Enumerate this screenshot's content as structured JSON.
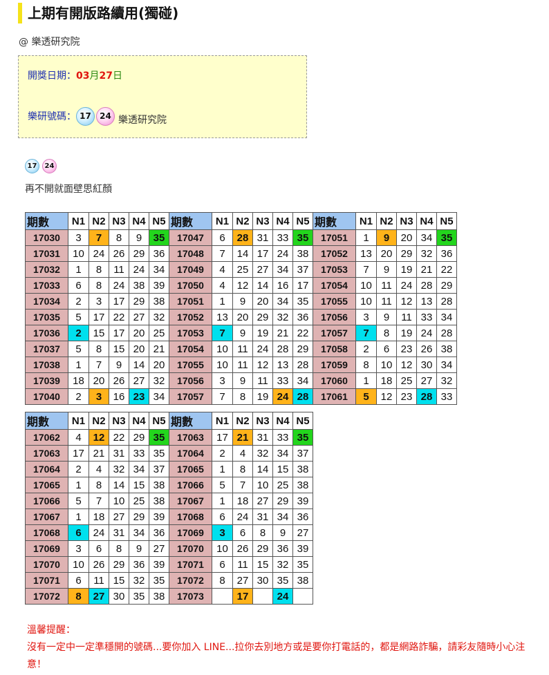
{
  "title": "上期有開版路續用(獨碰)",
  "author": "@ 樂透研究院",
  "info": {
    "date_label": "開獎日期：",
    "month": "03",
    "month_unit": "月",
    "day": "27",
    "day_unit": "日",
    "number_label": "樂研號碼：",
    "balls": [
      "17",
      "24"
    ],
    "site": "樂透研究院"
  },
  "picks": [
    "17",
    "24"
  ],
  "remark": "再不開就面壁思紅顏",
  "headers": [
    "期數",
    "N1",
    "N2",
    "N3",
    "N4",
    "N5"
  ],
  "blocks": [
    [
      {
        "period": "17030",
        "nums": [
          "3",
          "7",
          "8",
          "9",
          "35"
        ],
        "hl": [
          "",
          "o",
          "",
          "",
          "g"
        ]
      },
      {
        "period": "17031",
        "nums": [
          "10",
          "24",
          "26",
          "29",
          "36"
        ],
        "hl": [
          "",
          "",
          "",
          "",
          ""
        ]
      },
      {
        "period": "17032",
        "nums": [
          "1",
          "8",
          "11",
          "24",
          "34"
        ],
        "hl": [
          "",
          "",
          "",
          "",
          ""
        ]
      },
      {
        "period": "17033",
        "nums": [
          "6",
          "8",
          "24",
          "38",
          "39"
        ],
        "hl": [
          "",
          "",
          "",
          "",
          ""
        ]
      },
      {
        "period": "17034",
        "nums": [
          "2",
          "3",
          "17",
          "29",
          "38"
        ],
        "hl": [
          "",
          "",
          "",
          "",
          ""
        ]
      },
      {
        "period": "17035",
        "nums": [
          "5",
          "17",
          "22",
          "27",
          "32"
        ],
        "hl": [
          "",
          "",
          "",
          "",
          ""
        ]
      },
      {
        "period": "17036",
        "nums": [
          "2",
          "15",
          "17",
          "20",
          "25"
        ],
        "hl": [
          "c",
          "",
          "",
          "",
          ""
        ]
      },
      {
        "period": "17037",
        "nums": [
          "5",
          "8",
          "15",
          "20",
          "21"
        ],
        "hl": [
          "",
          "",
          "",
          "",
          ""
        ]
      },
      {
        "period": "17038",
        "nums": [
          "1",
          "7",
          "9",
          "14",
          "20"
        ],
        "hl": [
          "",
          "",
          "",
          "",
          ""
        ]
      },
      {
        "period": "17039",
        "nums": [
          "18",
          "20",
          "26",
          "27",
          "32"
        ],
        "hl": [
          "",
          "",
          "",
          "",
          ""
        ]
      },
      {
        "period": "17040",
        "nums": [
          "2",
          "3",
          "16",
          "23",
          "34"
        ],
        "hl": [
          "",
          "o",
          "",
          "c",
          ""
        ]
      }
    ],
    [
      {
        "period": "17047",
        "nums": [
          "6",
          "28",
          "31",
          "33",
          "35"
        ],
        "hl": [
          "",
          "o",
          "",
          "",
          "g"
        ]
      },
      {
        "period": "17048",
        "nums": [
          "7",
          "14",
          "17",
          "24",
          "38"
        ],
        "hl": [
          "",
          "",
          "",
          "",
          ""
        ]
      },
      {
        "period": "17049",
        "nums": [
          "4",
          "25",
          "27",
          "34",
          "37"
        ],
        "hl": [
          "",
          "",
          "",
          "",
          ""
        ]
      },
      {
        "period": "17050",
        "nums": [
          "4",
          "12",
          "14",
          "16",
          "17"
        ],
        "hl": [
          "",
          "",
          "",
          "",
          ""
        ]
      },
      {
        "period": "17051",
        "nums": [
          "1",
          "9",
          "20",
          "34",
          "35"
        ],
        "hl": [
          "",
          "",
          "",
          "",
          ""
        ]
      },
      {
        "period": "17052",
        "nums": [
          "13",
          "20",
          "29",
          "32",
          "36"
        ],
        "hl": [
          "",
          "",
          "",
          "",
          ""
        ]
      },
      {
        "period": "17053",
        "nums": [
          "7",
          "9",
          "19",
          "21",
          "22"
        ],
        "hl": [
          "c",
          "",
          "",
          "",
          ""
        ]
      },
      {
        "period": "17054",
        "nums": [
          "10",
          "11",
          "24",
          "28",
          "29"
        ],
        "hl": [
          "",
          "",
          "",
          "",
          ""
        ]
      },
      {
        "period": "17055",
        "nums": [
          "10",
          "11",
          "12",
          "13",
          "28"
        ],
        "hl": [
          "",
          "",
          "",
          "",
          ""
        ]
      },
      {
        "period": "17056",
        "nums": [
          "3",
          "9",
          "11",
          "33",
          "34"
        ],
        "hl": [
          "",
          "",
          "",
          "",
          ""
        ]
      },
      {
        "period": "17057",
        "nums": [
          "7",
          "8",
          "19",
          "24",
          "28"
        ],
        "hl": [
          "",
          "",
          "",
          "o",
          "c"
        ]
      }
    ],
    [
      {
        "period": "17051",
        "nums": [
          "1",
          "9",
          "20",
          "34",
          "35"
        ],
        "hl": [
          "",
          "o",
          "",
          "",
          "g"
        ]
      },
      {
        "period": "17052",
        "nums": [
          "13",
          "20",
          "29",
          "32",
          "36"
        ],
        "hl": [
          "",
          "",
          "",
          "",
          ""
        ]
      },
      {
        "period": "17053",
        "nums": [
          "7",
          "9",
          "19",
          "21",
          "22"
        ],
        "hl": [
          "",
          "",
          "",
          "",
          ""
        ]
      },
      {
        "period": "17054",
        "nums": [
          "10",
          "11",
          "24",
          "28",
          "29"
        ],
        "hl": [
          "",
          "",
          "",
          "",
          ""
        ]
      },
      {
        "period": "17055",
        "nums": [
          "10",
          "11",
          "12",
          "13",
          "28"
        ],
        "hl": [
          "",
          "",
          "",
          "",
          ""
        ]
      },
      {
        "period": "17056",
        "nums": [
          "3",
          "9",
          "11",
          "33",
          "34"
        ],
        "hl": [
          "",
          "",
          "",
          "",
          ""
        ]
      },
      {
        "period": "17057",
        "nums": [
          "7",
          "8",
          "19",
          "24",
          "28"
        ],
        "hl": [
          "c",
          "",
          "",
          "",
          ""
        ]
      },
      {
        "period": "17058",
        "nums": [
          "2",
          "6",
          "23",
          "26",
          "38"
        ],
        "hl": [
          "",
          "",
          "",
          "",
          ""
        ]
      },
      {
        "period": "17059",
        "nums": [
          "8",
          "10",
          "12",
          "30",
          "34"
        ],
        "hl": [
          "",
          "",
          "",
          "",
          ""
        ]
      },
      {
        "period": "17060",
        "nums": [
          "1",
          "18",
          "25",
          "27",
          "32"
        ],
        "hl": [
          "",
          "",
          "",
          "",
          ""
        ]
      },
      {
        "period": "17061",
        "nums": [
          "5",
          "12",
          "23",
          "28",
          "33"
        ],
        "hl": [
          "o",
          "",
          "",
          "c",
          ""
        ]
      }
    ],
    [
      {
        "period": "17062",
        "nums": [
          "4",
          "12",
          "22",
          "29",
          "35"
        ],
        "hl": [
          "",
          "o",
          "",
          "",
          "g"
        ]
      },
      {
        "period": "17063",
        "nums": [
          "17",
          "21",
          "31",
          "33",
          "35"
        ],
        "hl": [
          "",
          "",
          "",
          "",
          ""
        ]
      },
      {
        "period": "17064",
        "nums": [
          "2",
          "4",
          "32",
          "34",
          "37"
        ],
        "hl": [
          "",
          "",
          "",
          "",
          ""
        ]
      },
      {
        "period": "17065",
        "nums": [
          "1",
          "8",
          "14",
          "15",
          "38"
        ],
        "hl": [
          "",
          "",
          "",
          "",
          ""
        ]
      },
      {
        "period": "17066",
        "nums": [
          "5",
          "7",
          "10",
          "25",
          "38"
        ],
        "hl": [
          "",
          "",
          "",
          "",
          ""
        ]
      },
      {
        "period": "17067",
        "nums": [
          "1",
          "18",
          "27",
          "29",
          "39"
        ],
        "hl": [
          "",
          "",
          "",
          "",
          ""
        ]
      },
      {
        "period": "17068",
        "nums": [
          "6",
          "24",
          "31",
          "34",
          "36"
        ],
        "hl": [
          "c",
          "",
          "",
          "",
          ""
        ]
      },
      {
        "period": "17069",
        "nums": [
          "3",
          "6",
          "8",
          "9",
          "27"
        ],
        "hl": [
          "",
          "",
          "",
          "",
          ""
        ]
      },
      {
        "period": "17070",
        "nums": [
          "10",
          "26",
          "29",
          "36",
          "39"
        ],
        "hl": [
          "",
          "",
          "",
          "",
          ""
        ]
      },
      {
        "period": "17071",
        "nums": [
          "6",
          "11",
          "15",
          "32",
          "35"
        ],
        "hl": [
          "",
          "",
          "",
          "",
          ""
        ]
      },
      {
        "period": "17072",
        "nums": [
          "8",
          "27",
          "30",
          "35",
          "38"
        ],
        "hl": [
          "o",
          "c",
          "",
          "",
          ""
        ]
      }
    ],
    [
      {
        "period": "17063",
        "nums": [
          "17",
          "21",
          "31",
          "33",
          "35"
        ],
        "hl": [
          "",
          "o",
          "",
          "",
          "g"
        ]
      },
      {
        "period": "17064",
        "nums": [
          "2",
          "4",
          "32",
          "34",
          "37"
        ],
        "hl": [
          "",
          "",
          "",
          "",
          ""
        ]
      },
      {
        "period": "17065",
        "nums": [
          "1",
          "8",
          "14",
          "15",
          "38"
        ],
        "hl": [
          "",
          "",
          "",
          "",
          ""
        ]
      },
      {
        "period": "17066",
        "nums": [
          "5",
          "7",
          "10",
          "25",
          "38"
        ],
        "hl": [
          "",
          "",
          "",
          "",
          ""
        ]
      },
      {
        "period": "17067",
        "nums": [
          "1",
          "18",
          "27",
          "29",
          "39"
        ],
        "hl": [
          "",
          "",
          "",
          "",
          ""
        ]
      },
      {
        "period": "17068",
        "nums": [
          "6",
          "24",
          "31",
          "34",
          "36"
        ],
        "hl": [
          "",
          "",
          "",
          "",
          ""
        ]
      },
      {
        "period": "17069",
        "nums": [
          "3",
          "6",
          "8",
          "9",
          "27"
        ],
        "hl": [
          "c",
          "",
          "",
          "",
          ""
        ]
      },
      {
        "period": "17070",
        "nums": [
          "10",
          "26",
          "29",
          "36",
          "39"
        ],
        "hl": [
          "",
          "",
          "",
          "",
          ""
        ]
      },
      {
        "period": "17071",
        "nums": [
          "6",
          "11",
          "15",
          "32",
          "35"
        ],
        "hl": [
          "",
          "",
          "",
          "",
          ""
        ]
      },
      {
        "period": "17072",
        "nums": [
          "8",
          "27",
          "30",
          "35",
          "38"
        ],
        "hl": [
          "",
          "",
          "",
          "",
          ""
        ]
      },
      {
        "period": "17073",
        "nums": [
          "",
          "17",
          "",
          "24",
          ""
        ],
        "hl": [
          "",
          "o",
          "",
          "c",
          ""
        ]
      }
    ]
  ],
  "warning": {
    "label": "溫馨提醒：",
    "text": "沒有一定中一定準穩開的號碼...要你加入 LINE...拉你去別地方或是要你打電話的，都是網路詐騙，請彩友隨時小心注意！"
  }
}
